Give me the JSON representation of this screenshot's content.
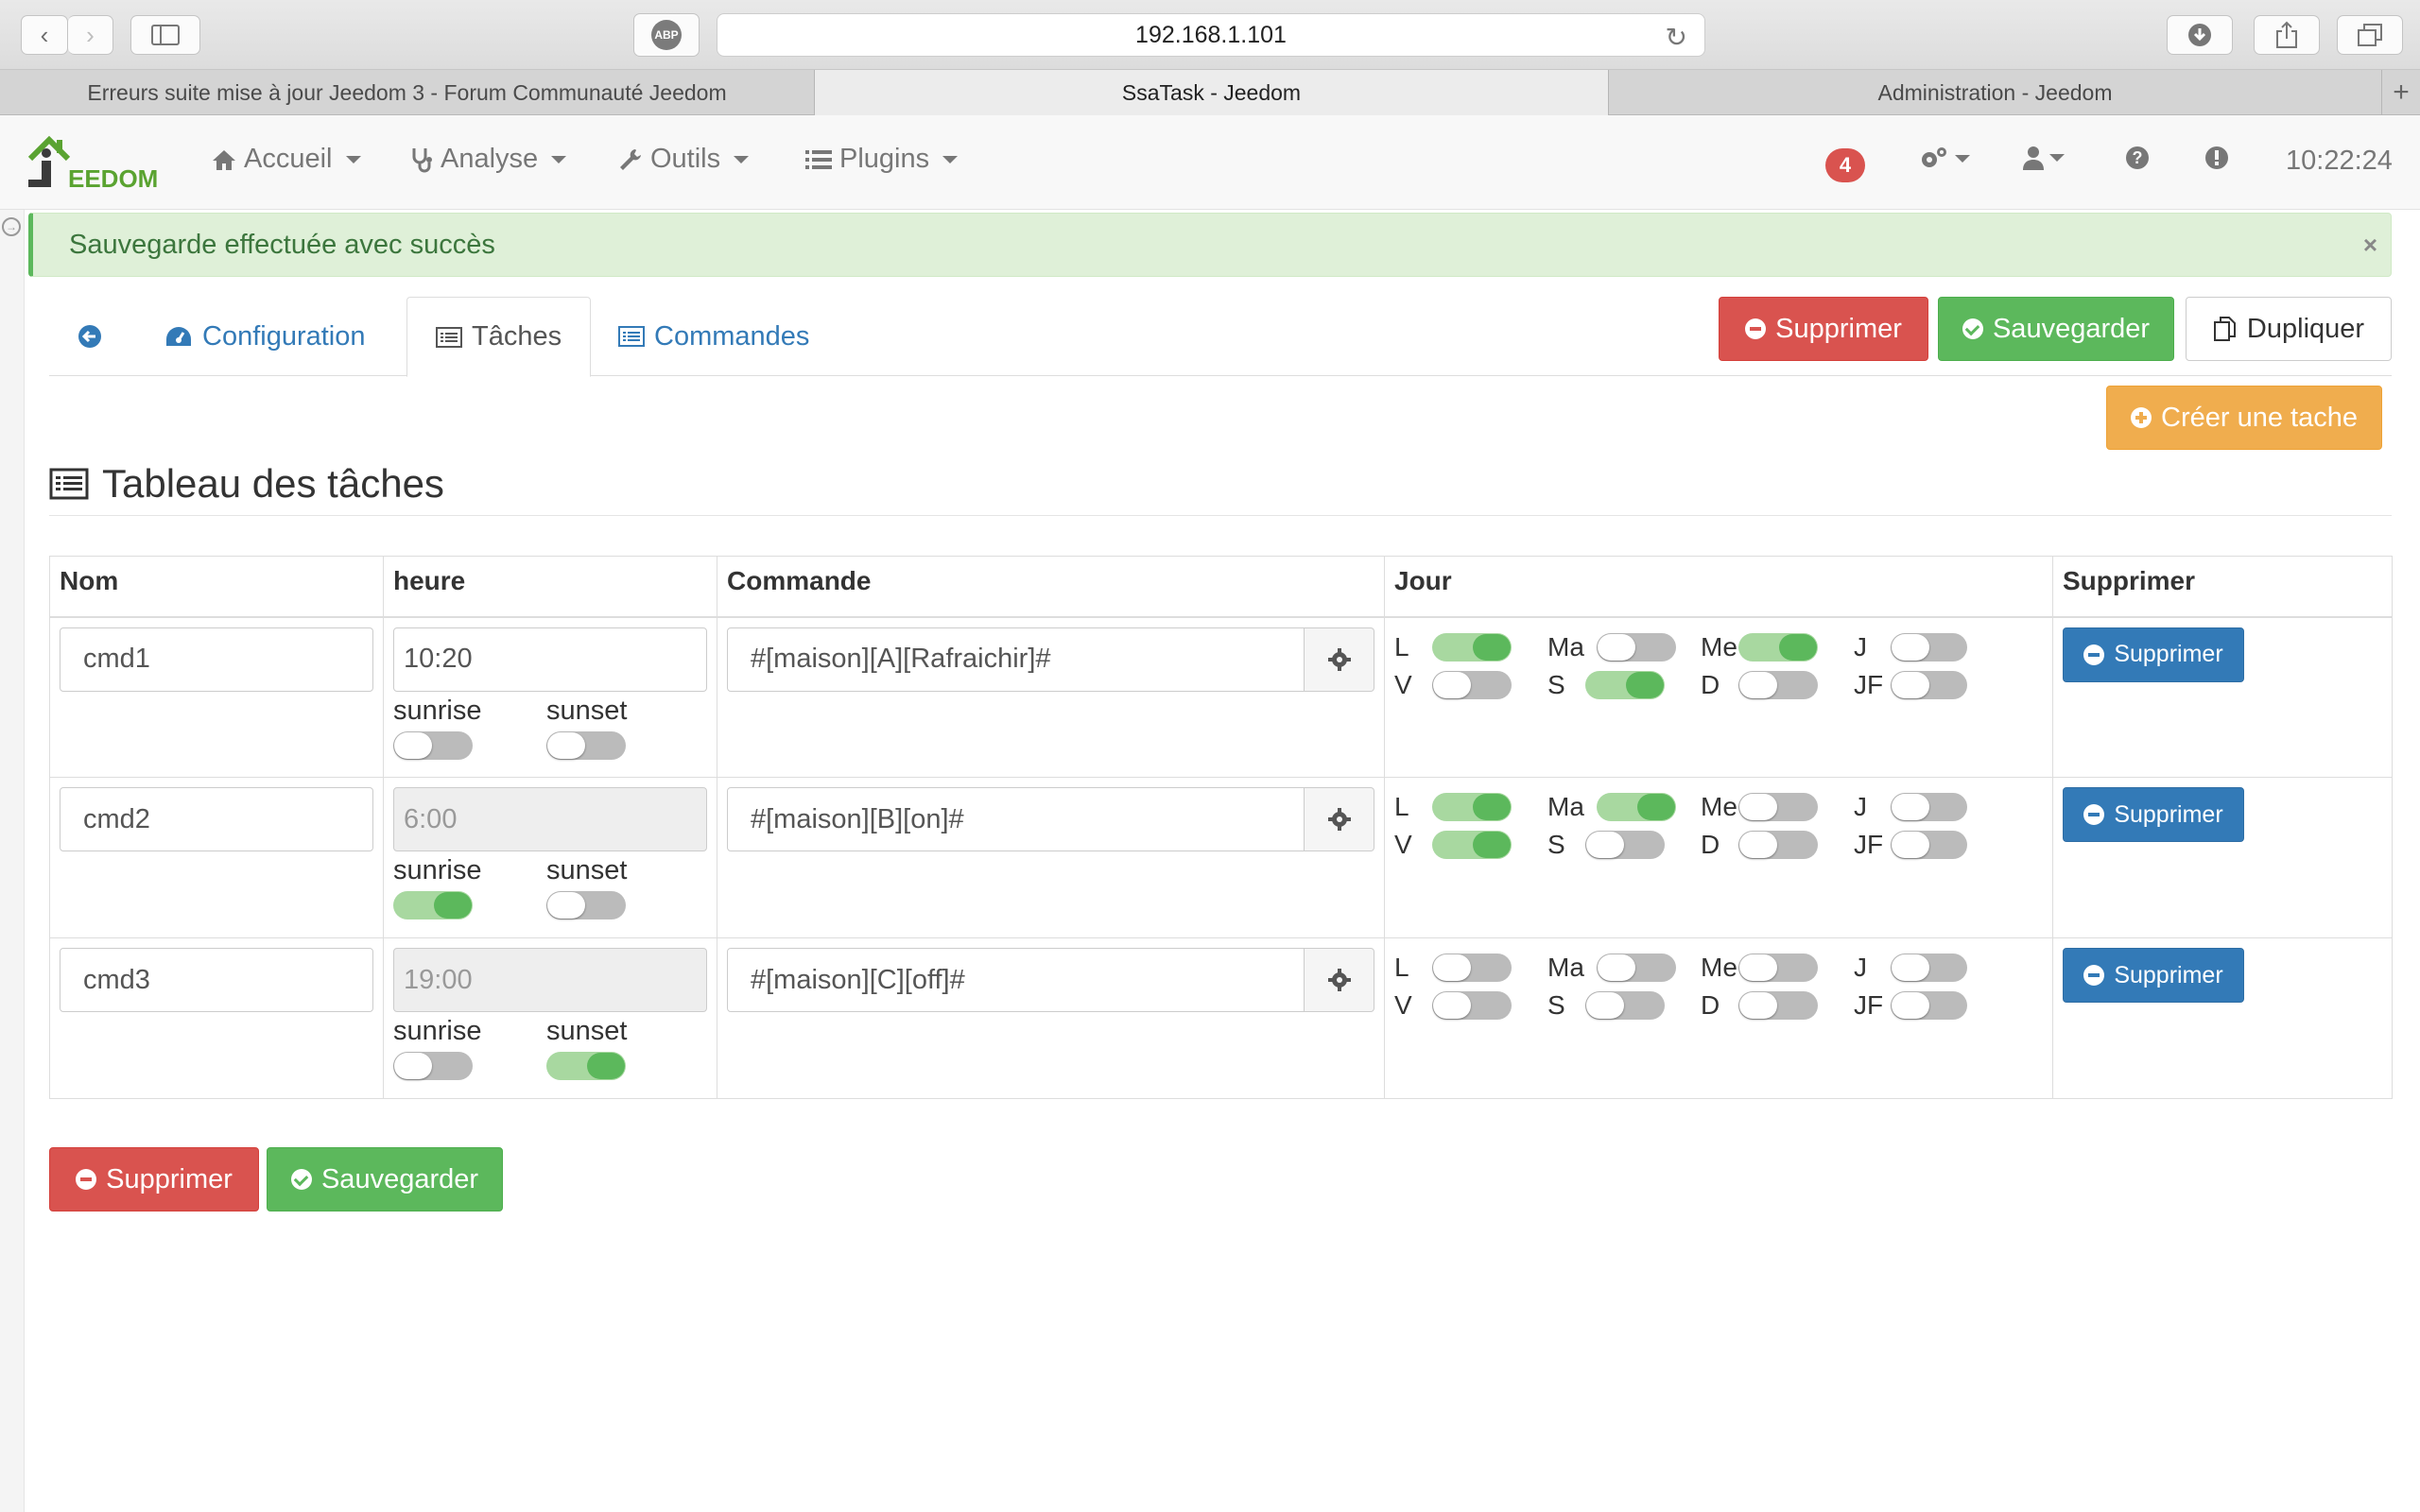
{
  "browser": {
    "url": "192.168.1.101",
    "tabs": [
      {
        "label": "Erreurs suite mise à jour Jeedom 3 - Forum Communauté Jeedom",
        "active": false
      },
      {
        "label": "SsaTask - Jeedom",
        "active": true
      },
      {
        "label": "Administration - Jeedom",
        "active": false
      }
    ],
    "abp_label": "ABP",
    "new_tab": "+"
  },
  "navbar": {
    "logo_text": "EEDOM",
    "menu": [
      {
        "label": "Accueil",
        "icon": "home-icon"
      },
      {
        "label": "Analyse",
        "icon": "stethoscope-icon"
      },
      {
        "label": "Outils",
        "icon": "wrench-icon"
      },
      {
        "label": "Plugins",
        "icon": "list-icon"
      }
    ],
    "notification_count": "4",
    "time": "10:22:24"
  },
  "alert": {
    "message": "Sauvegarde effectuée avec succès",
    "close": "×"
  },
  "tabs": {
    "configuration": "Configuration",
    "taches": "Tâches",
    "commandes": "Commandes"
  },
  "actions": {
    "supprimer": "Supprimer",
    "sauvegarder": "Sauvegarder",
    "dupliquer": "Dupliquer",
    "creer": "Créer une tache"
  },
  "section_title": "Tableau des tâches",
  "table": {
    "headers": [
      "Nom",
      "heure",
      "Commande",
      "Jour",
      "Supprimer"
    ],
    "sunrise_label": "sunrise",
    "sunset_label": "sunset",
    "delete_label": "Supprimer",
    "day_labels": [
      "L",
      "Ma",
      "Me",
      "J",
      "V",
      "S",
      "D",
      "JF"
    ],
    "rows": [
      {
        "nom": "cmd1",
        "heure": "10:20",
        "heure_disabled": false,
        "sunrise": false,
        "sunset": false,
        "commande": "#[maison][A][Rafraichir]#",
        "days": {
          "L": true,
          "Ma": false,
          "Me": true,
          "J": false,
          "V": false,
          "S": true,
          "D": false,
          "JF": false
        }
      },
      {
        "nom": "cmd2",
        "heure": "6:00",
        "heure_disabled": true,
        "sunrise": true,
        "sunset": false,
        "commande": "#[maison][B][on]#",
        "days": {
          "L": true,
          "Ma": true,
          "Me": false,
          "J": false,
          "V": true,
          "S": false,
          "D": false,
          "JF": false
        }
      },
      {
        "nom": "cmd3",
        "heure": "19:00",
        "heure_disabled": true,
        "sunrise": false,
        "sunset": true,
        "commande": "#[maison][C][off]#",
        "days": {
          "L": false,
          "Ma": false,
          "Me": false,
          "J": false,
          "V": false,
          "S": false,
          "D": false,
          "JF": false
        }
      }
    ]
  },
  "bottom_actions": {
    "supprimer": "Supprimer",
    "sauvegarder": "Sauvegarder"
  }
}
